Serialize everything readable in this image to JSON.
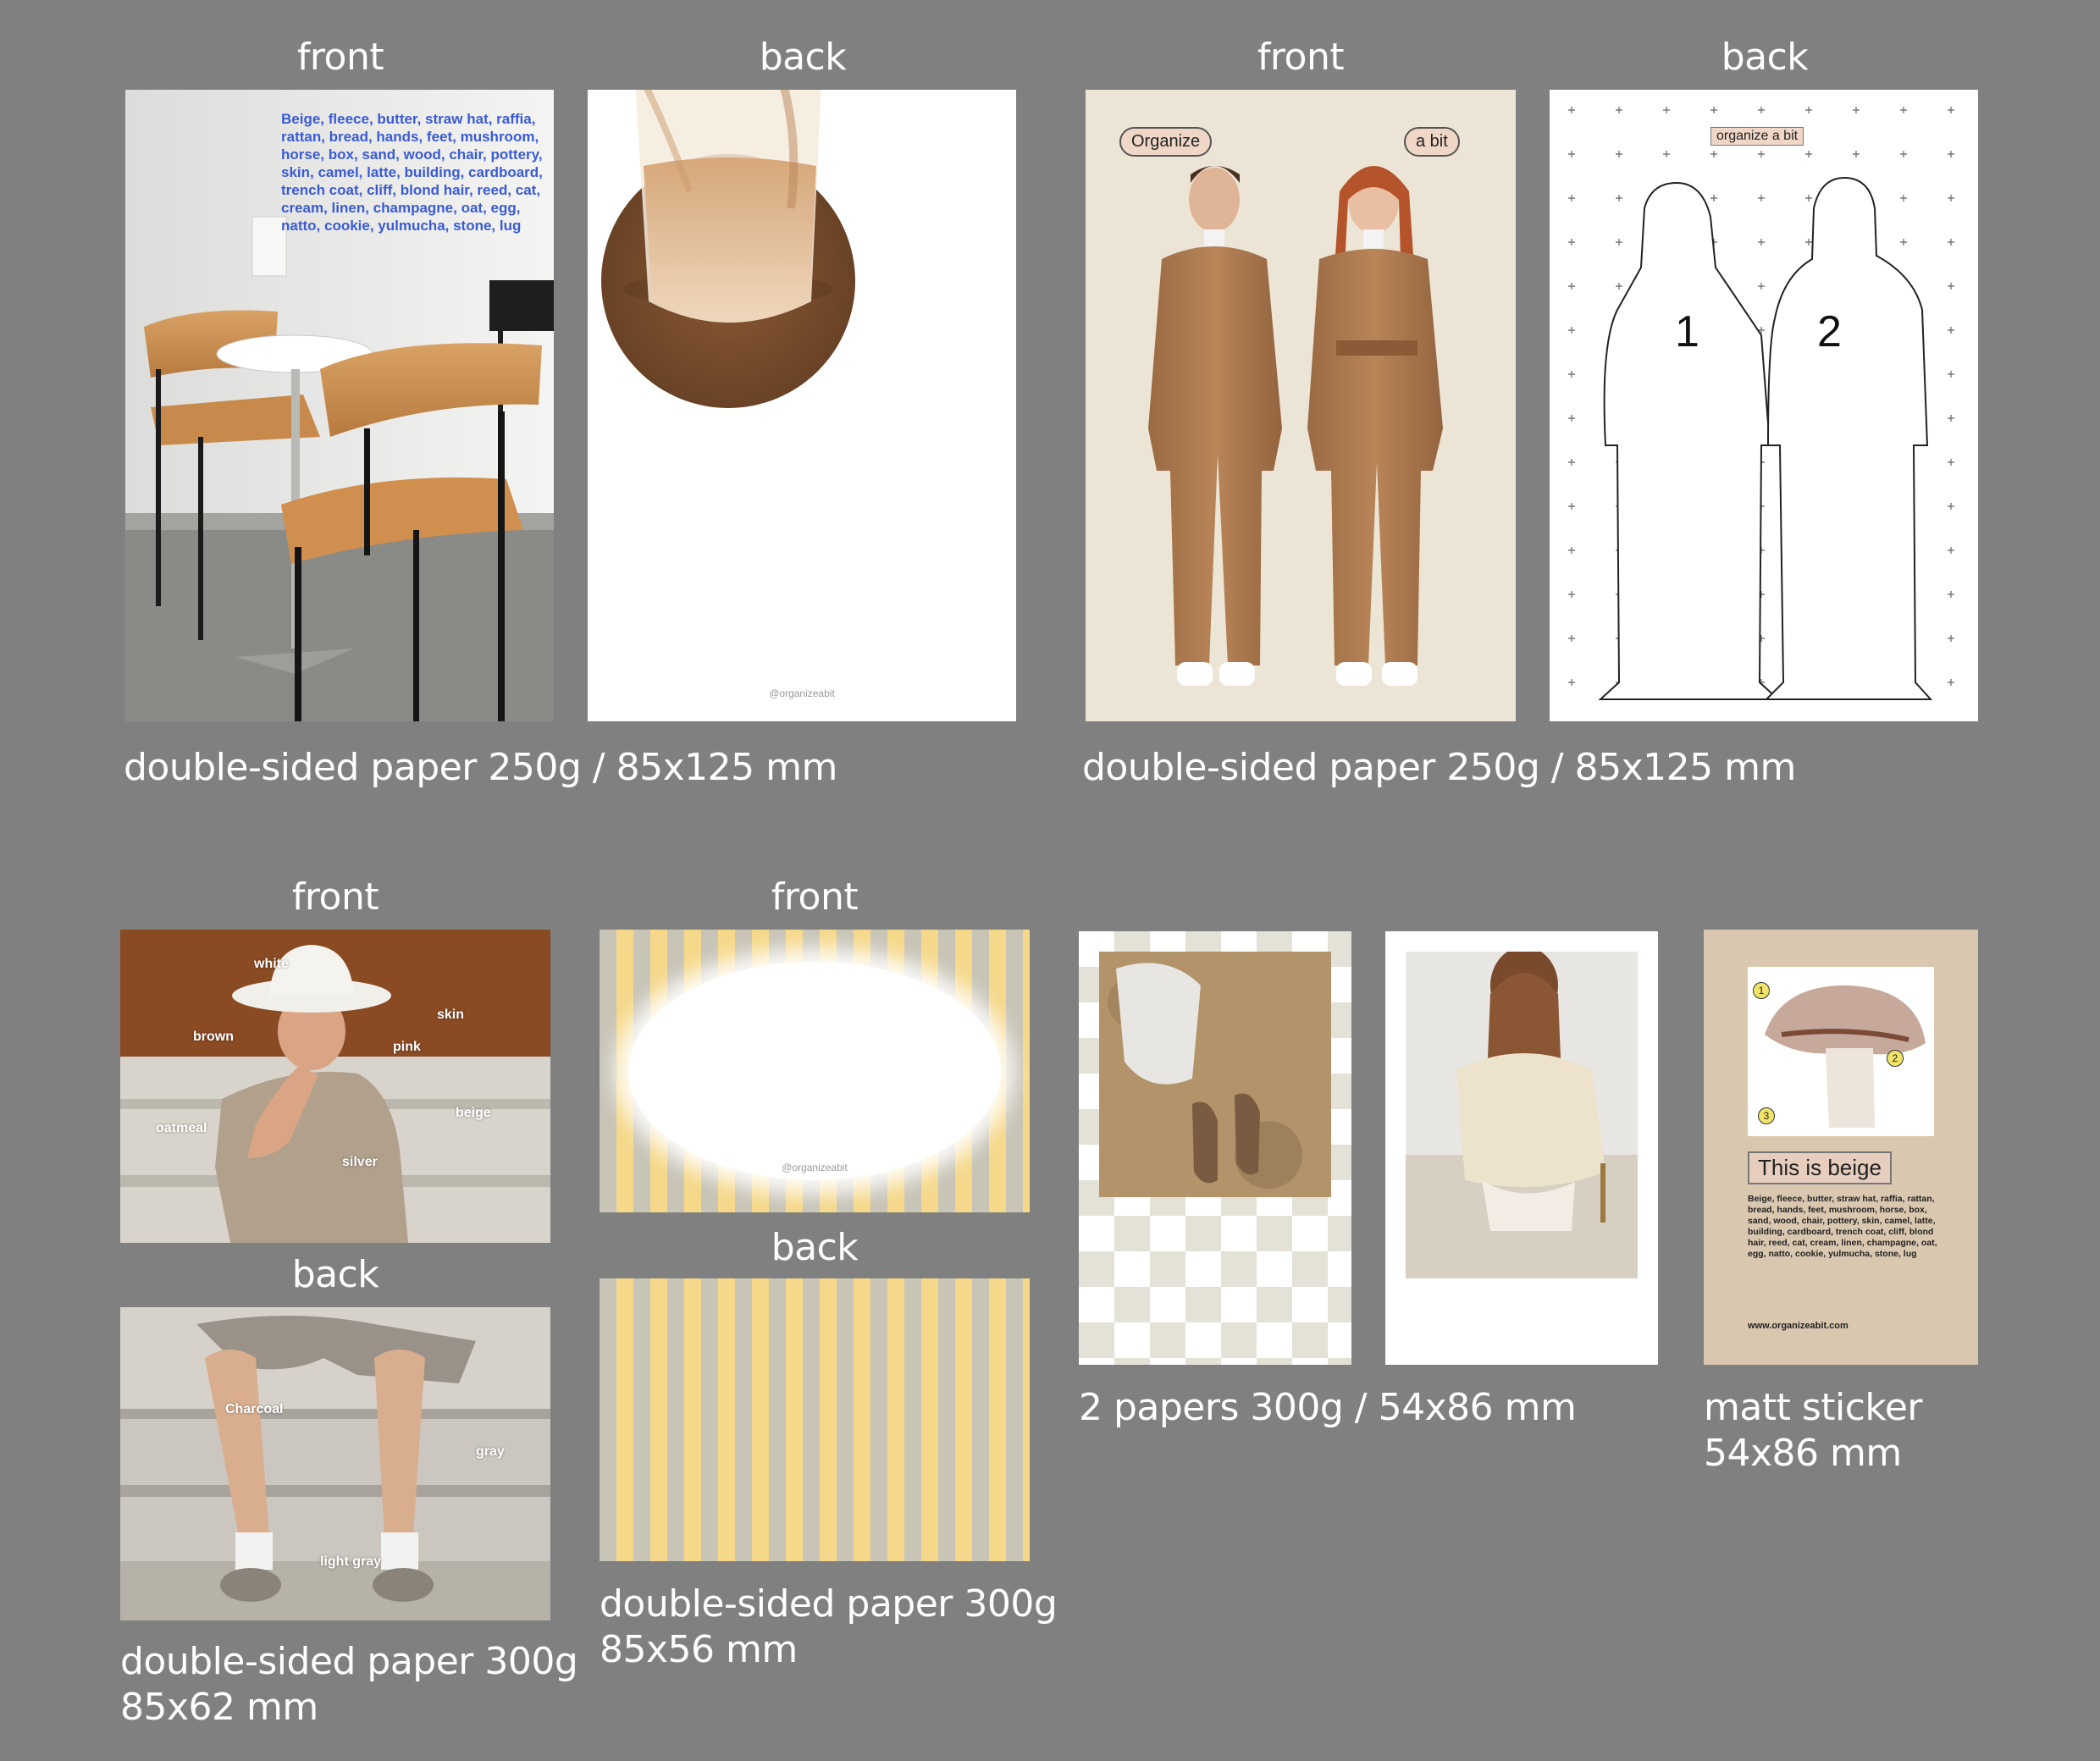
{
  "labels": {
    "front": "front",
    "back": "back"
  },
  "card1": {
    "words": "Beige, fleece, butter, straw hat, raffia, rattan, bread, hands, feet, mushroom, horse, box, sand, wood, chair, pottery, skin, camel, latte, building, cardboard, trench coat, cliff, blond hair, reed, cat, cream, linen, champagne, oat, egg, natto, cookie, yulmucha, stone, lug",
    "handle": "@organizeabit",
    "caption": "double-sided paper 250g / 85x125 mm"
  },
  "card2": {
    "bubble_left": "Organize",
    "bubble_right": "a bit",
    "back_tag": "organize a bit",
    "num1": "1",
    "num2": "2",
    "caption": "double-sided paper 250g / 85x125 mm"
  },
  "card3": {
    "front_tags": [
      "white",
      "skin",
      "brown",
      "pink",
      "beige",
      "oatmeal",
      "silver"
    ],
    "back_tags": [
      "Charcoal",
      "gray",
      "light gray"
    ],
    "caption_line1": "double-sided paper 300g",
    "caption_line2": "85x62 mm"
  },
  "card4": {
    "handle": "@organizeabit",
    "caption_line1": "double-sided paper 300g",
    "caption_line2": "85x56 mm"
  },
  "card5": {
    "caption": "2 papers 300g / 54x86 mm"
  },
  "card6": {
    "title": "This is beige",
    "body": "Beige, fleece, butter, straw hat, raffia, rattan, bread, hands, feet, mushroom, horse, box, sand, wood, chair, pottery, skin, camel, latte, building, cardboard, trench coat, cliff, blond hair, reed, cat, cream, linen, champagne, oat, egg, natto, cookie, yulmucha, stone, lug",
    "url": "www.organizeabit.com",
    "markers": [
      "1",
      "2",
      "3"
    ],
    "caption_line1": "matt sticker",
    "caption_line2": "54x86 mm"
  }
}
